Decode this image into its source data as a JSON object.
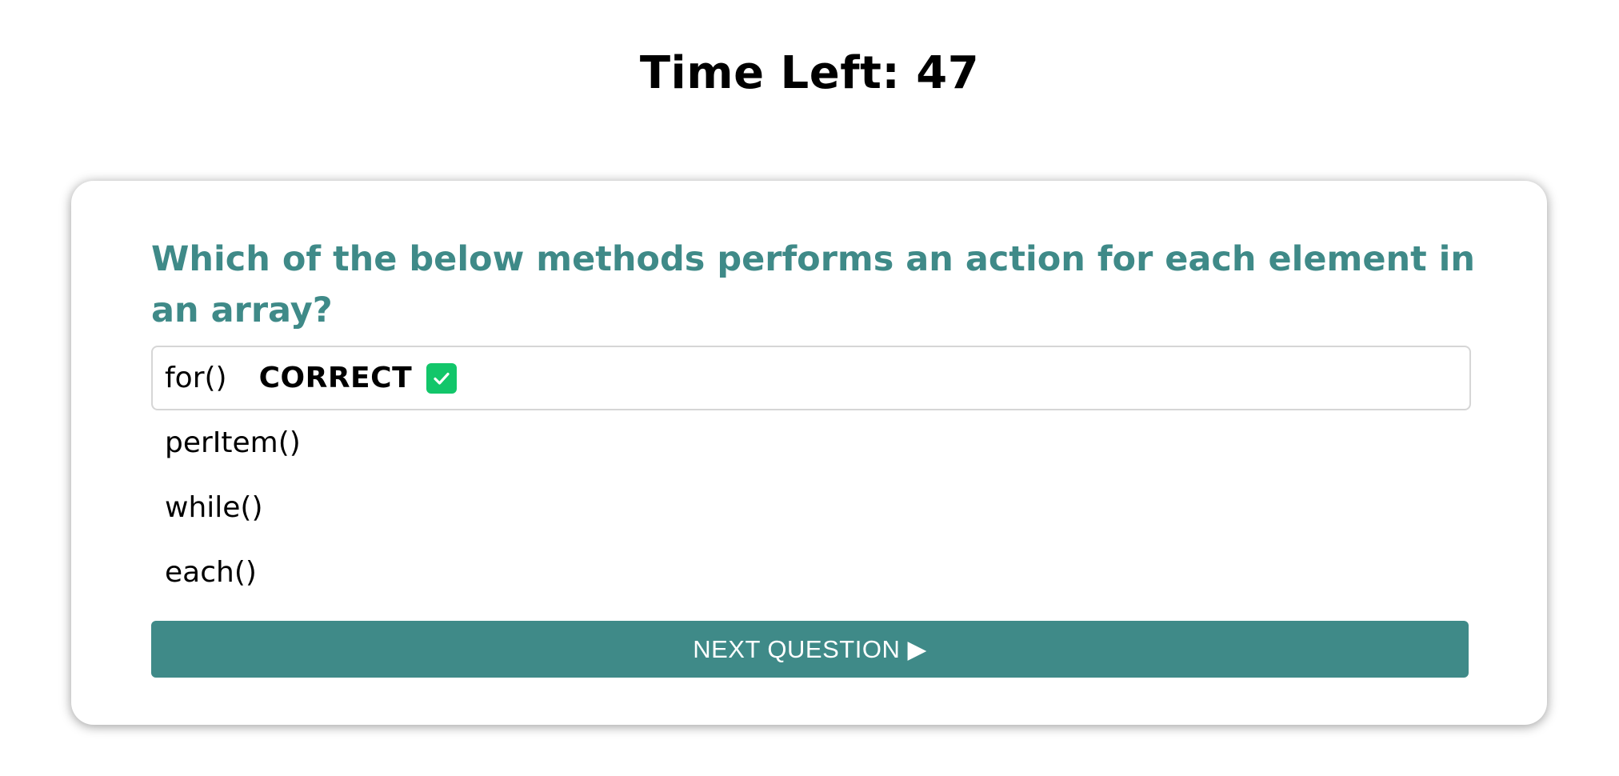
{
  "timer": {
    "text": "Time Left: 47"
  },
  "quiz": {
    "question": "Which of the below methods performs an action for each element in an array?",
    "answers": [
      {
        "label": "for()",
        "selected": true,
        "result": "CORRECT",
        "result_icon": "check-icon"
      },
      {
        "label": "perItem()"
      },
      {
        "label": "while()"
      },
      {
        "label": "each()"
      }
    ],
    "next_button_label": "NEXT QUESTION ▶"
  },
  "colors": {
    "accent": "#3f8a88",
    "correct": "#12c66a",
    "text": "#000000",
    "background": "#ffffff"
  }
}
